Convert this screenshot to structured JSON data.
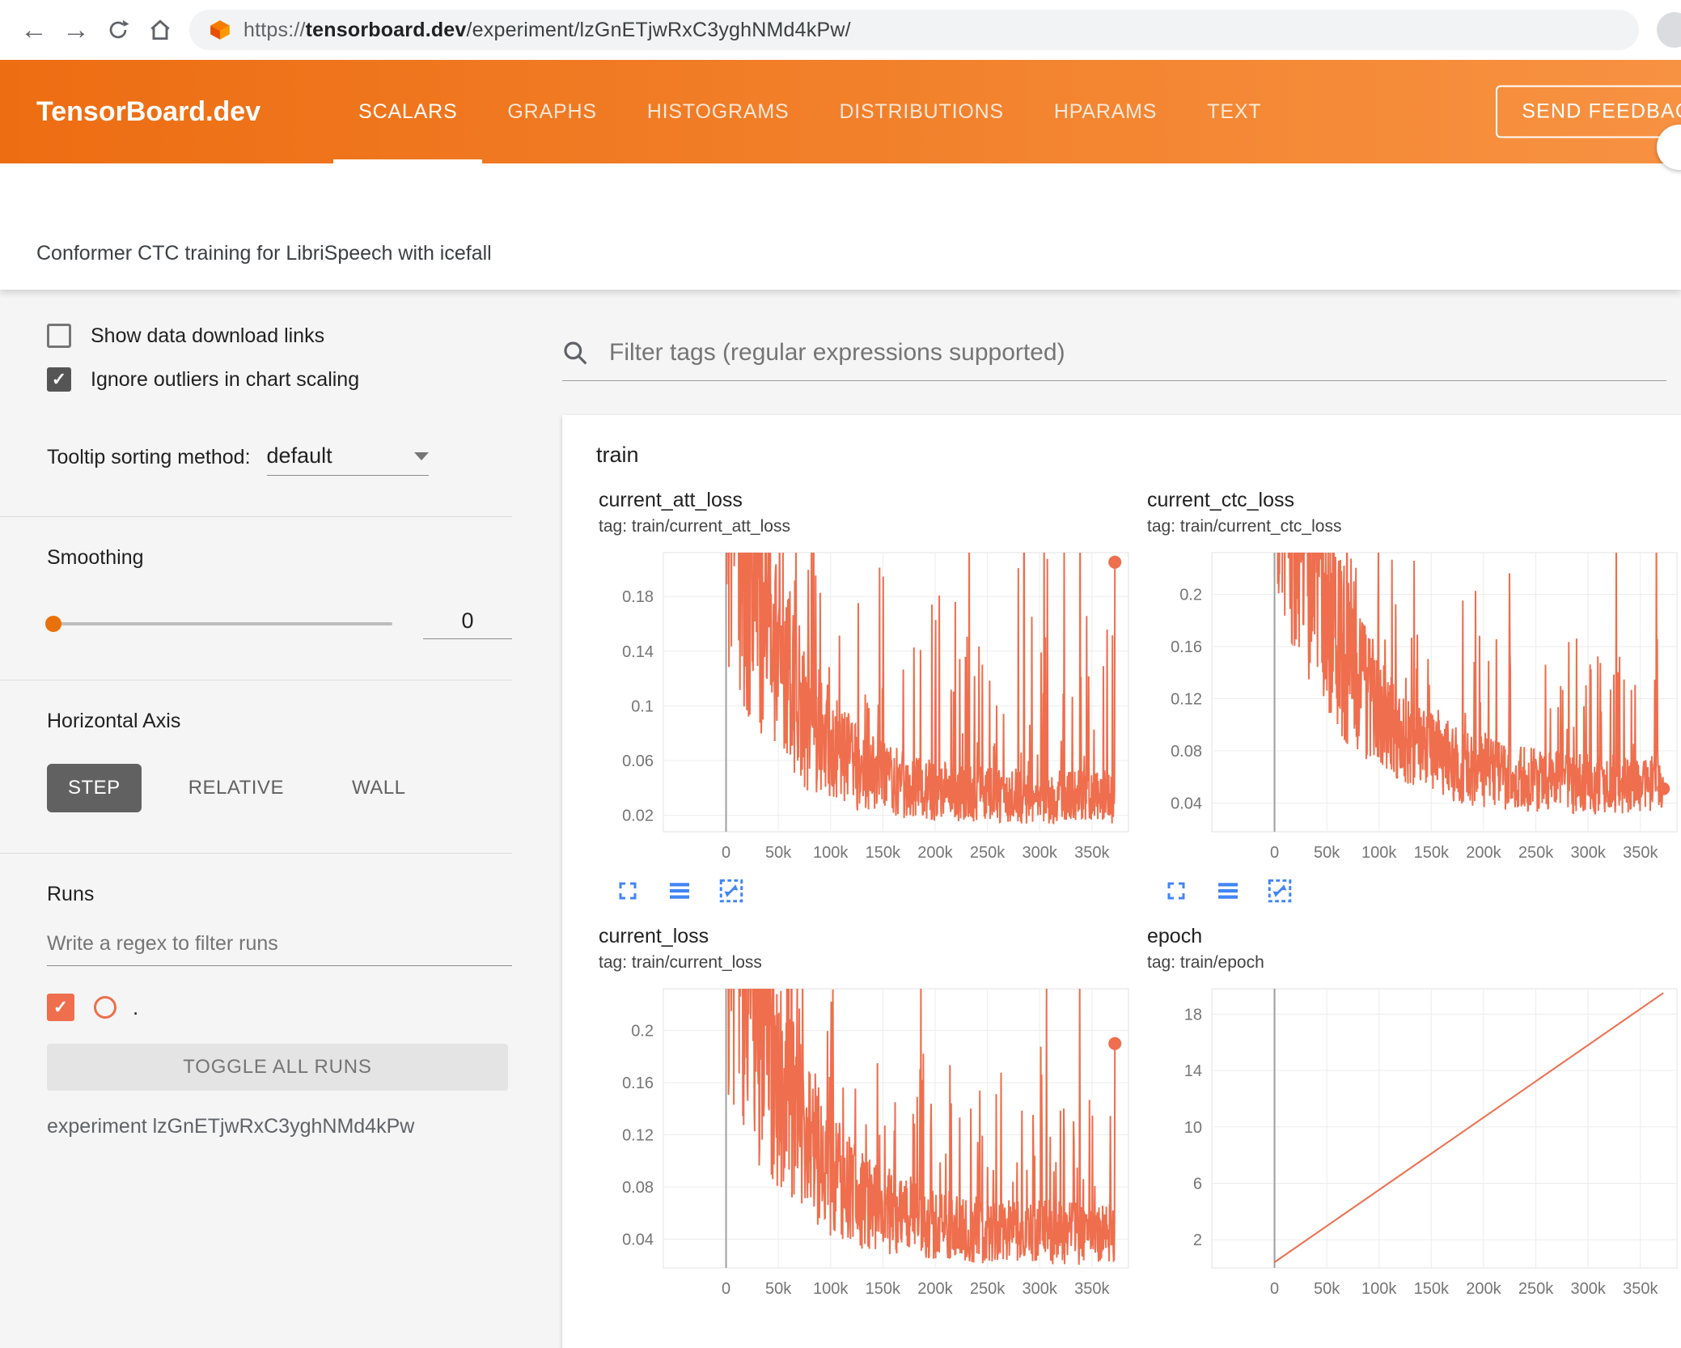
{
  "browser": {
    "url": {
      "scheme": "https://",
      "host": "tensorboard.dev",
      "path": "/experiment/lzGnETjwRxC3yghNMd4kPw/"
    },
    "icons": {
      "back": "←",
      "forward": "→"
    }
  },
  "header": {
    "brand": "TensorBoard.dev",
    "tabs": [
      {
        "label": "SCALARS",
        "active": true
      },
      {
        "label": "GRAPHS",
        "active": false
      },
      {
        "label": "HISTOGRAMS",
        "active": false
      },
      {
        "label": "DISTRIBUTIONS",
        "active": false
      },
      {
        "label": "HPARAMS",
        "active": false
      },
      {
        "label": "TEXT",
        "active": false
      }
    ],
    "feedback_label": "SEND FEEDBACK"
  },
  "experiment": {
    "title": "Conformer CTC training for LibriSpeech with icefall",
    "id_label": "experiment lzGnETjwRxC3yghNMd4kPw"
  },
  "sidebar": {
    "show_download_label": "Show data download links",
    "ignore_outliers_label": "Ignore outliers in chart scaling",
    "tooltip_sorting_label": "Tooltip sorting method:",
    "tooltip_sorting_value": "default",
    "smoothing_label": "Smoothing",
    "smoothing_value": "0",
    "horizontal_axis_label": "Horizontal Axis",
    "axis_options": [
      {
        "label": "STEP",
        "active": true
      },
      {
        "label": "RELATIVE",
        "active": false
      },
      {
        "label": "WALL",
        "active": false
      }
    ],
    "runs_label": "Runs",
    "runs_filter_placeholder": "Write a regex to filter runs",
    "run_label": ".",
    "toggle_all_label": "TOGGLE ALL RUNS"
  },
  "main": {
    "filter_placeholder": "Filter tags (regular expressions supported)",
    "group_label": "train"
  },
  "colors": {
    "header_orange": "#ee7420",
    "series_orange": "#ee6e4d",
    "icon_blue": "#4285f4"
  },
  "chart_data": [
    {
      "type": "line_noisy",
      "title": "current_att_loss",
      "tag": "tag: train/current_att_loss",
      "x_ticks": {
        "values": [
          0,
          50000,
          100000,
          150000,
          200000,
          250000,
          300000,
          350000
        ],
        "labels": [
          "0",
          "50k",
          "100k",
          "150k",
          "200k",
          "250k",
          "300k",
          "350k"
        ]
      },
      "y_ticks": {
        "values": [
          0.02,
          0.06,
          0.1,
          0.14,
          0.18
        ],
        "labels": [
          "0.02",
          "0.06",
          "0.1",
          "0.14",
          "0.18"
        ]
      },
      "x_domain": [
        -60000,
        385000
      ],
      "y_domain": [
        0.008,
        0.212
      ],
      "x_range": [
        0,
        372000
      ],
      "gen": {
        "seed": 3,
        "a": 0.26,
        "k": 7.5,
        "c": 0.03,
        "noise": [
          0.45,
          1.75
        ],
        "spike_p": 0.1,
        "spike_m": 0.13,
        "n": 950,
        "end_value": 0.205
      },
      "marker_end": true,
      "color": "#ee6e4d"
    },
    {
      "type": "line_noisy",
      "title": "current_ctc_loss",
      "tag": "tag: train/current_ctc_loss",
      "x_ticks": {
        "values": [
          0,
          50000,
          100000,
          150000,
          200000,
          250000,
          300000,
          350000
        ],
        "labels": [
          "0",
          "50k",
          "100k",
          "150k",
          "200k",
          "250k",
          "300k",
          "350k"
        ]
      },
      "y_ticks": {
        "values": [
          0.04,
          0.08,
          0.12,
          0.16,
          0.2
        ],
        "labels": [
          "0.04",
          "0.08",
          "0.12",
          "0.16",
          "0.2"
        ]
      },
      "x_domain": [
        -60000,
        385000
      ],
      "y_domain": [
        0.018,
        0.232
      ],
      "x_range": [
        0,
        372000
      ],
      "gen": {
        "seed": 17,
        "a": 0.28,
        "k": 6,
        "c": 0.05,
        "noise": [
          0.6,
          1.5
        ],
        "spike_p": 0.09,
        "spike_m": 0.11,
        "n": 950,
        "end_value": 0.051
      },
      "marker_end": true,
      "color": "#ee6e4d"
    },
    {
      "type": "line_noisy",
      "title": "current_loss",
      "tag": "tag: train/current_loss",
      "x_ticks": {
        "values": [
          0,
          50000,
          100000,
          150000,
          200000,
          250000,
          300000,
          350000
        ],
        "labels": [
          "0",
          "50k",
          "100k",
          "150k",
          "200k",
          "250k",
          "300k",
          "350k"
        ]
      },
      "y_ticks": {
        "values": [
          0.04,
          0.08,
          0.12,
          0.16,
          0.2
        ],
        "labels": [
          "0.04",
          "0.08",
          "0.12",
          "0.16",
          "0.2"
        ]
      },
      "x_domain": [
        -60000,
        385000
      ],
      "y_domain": [
        0.018,
        0.232
      ],
      "x_range": [
        0,
        372000
      ],
      "gen": {
        "seed": 42,
        "a": 0.27,
        "k": 6.8,
        "c": 0.04,
        "noise": [
          0.5,
          1.7
        ],
        "spike_p": 0.1,
        "spike_m": 0.12,
        "n": 950,
        "end_value": 0.19
      },
      "marker_end": true,
      "color": "#ee6e4d"
    },
    {
      "type": "line_linear",
      "title": "epoch",
      "tag": "tag: train/epoch",
      "x_ticks": {
        "values": [
          0,
          50000,
          100000,
          150000,
          200000,
          250000,
          300000,
          350000
        ],
        "labels": [
          "0",
          "50k",
          "100k",
          "150k",
          "200k",
          "250k",
          "300k",
          "350k"
        ]
      },
      "y_ticks": {
        "values": [
          2,
          6,
          10,
          14,
          18
        ],
        "labels": [
          "2",
          "6",
          "10",
          "14",
          "18"
        ]
      },
      "x_domain": [
        -60000,
        385000
      ],
      "y_domain": [
        0,
        19.8
      ],
      "points": [
        [
          0,
          0.4
        ],
        [
          372000,
          19.5
        ]
      ],
      "marker_end": false,
      "color": "#ee6e4d"
    }
  ]
}
